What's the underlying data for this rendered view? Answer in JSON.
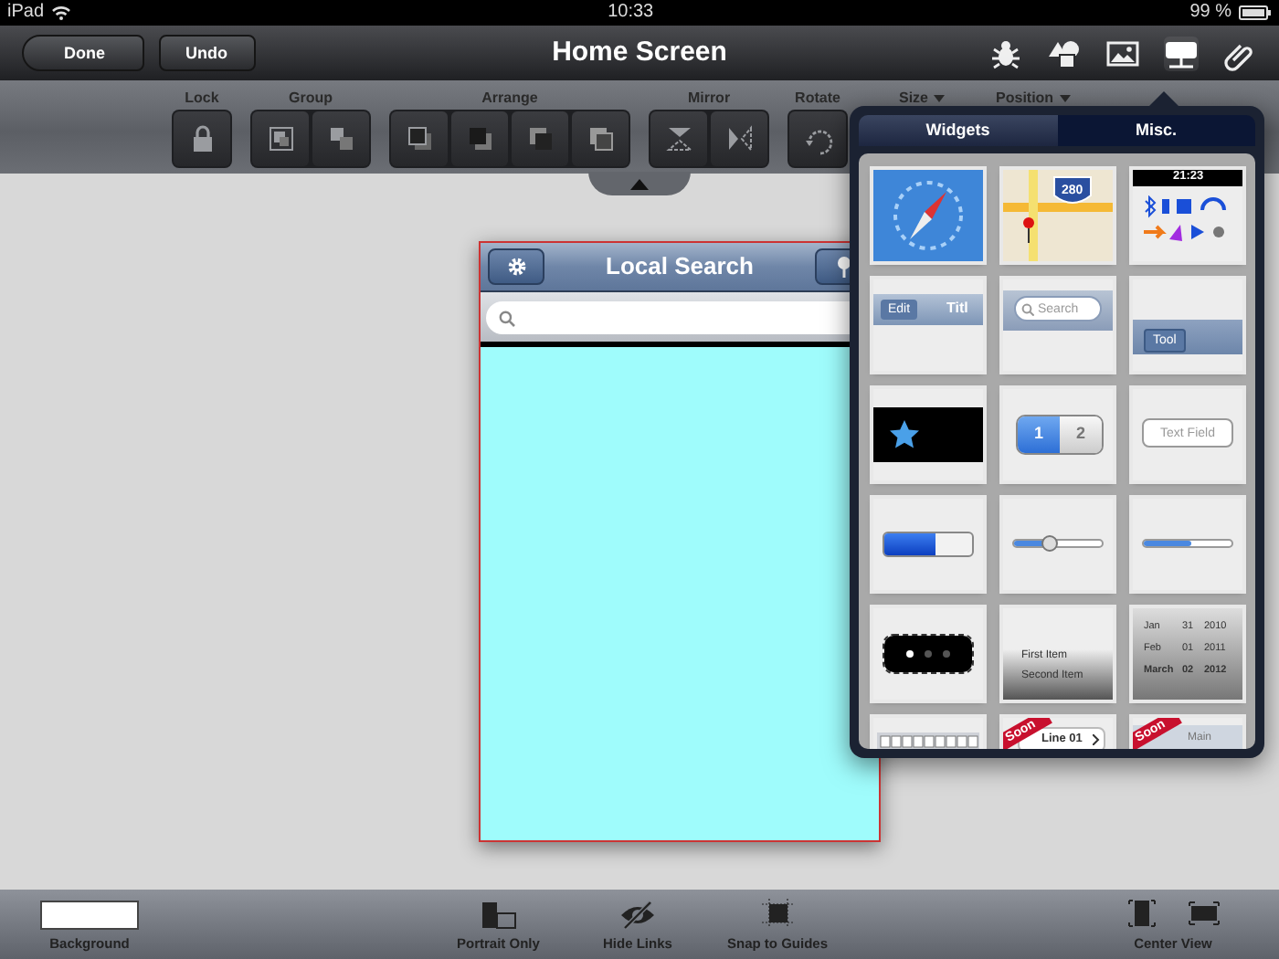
{
  "status_bar": {
    "device": "iPad",
    "time": "10:33",
    "battery": "99 %"
  },
  "nav_bar": {
    "title": "Home Screen",
    "buttons": [
      {
        "label": "Done",
        "kind": "back"
      },
      {
        "label": "Undo",
        "kind": "plain"
      }
    ],
    "icons": [
      {
        "kind": "bug",
        "selected": false
      },
      {
        "kind": "shapes",
        "selected": false
      },
      {
        "kind": "image",
        "selected": false
      },
      {
        "kind": "widget",
        "selected": true
      },
      {
        "kind": "clip",
        "selected": false
      }
    ]
  },
  "toolbar": {
    "groups": [
      {
        "label": "Lock",
        "kind": "buttons",
        "buttons": [
          {
            "kind": "lock"
          }
        ]
      },
      {
        "label": "Group",
        "kind": "buttons",
        "buttons": [
          {
            "kind": "group"
          },
          {
            "kind": "ungroup"
          }
        ]
      },
      {
        "label": "Arrange",
        "kind": "buttons",
        "buttons": [
          {
            "kind": "front"
          },
          {
            "kind": "forward"
          },
          {
            "kind": "backward"
          },
          {
            "kind": "back"
          }
        ]
      },
      {
        "label": "Mirror",
        "kind": "buttons",
        "buttons": [
          {
            "kind": "flipv"
          },
          {
            "kind": "fliph"
          }
        ]
      },
      {
        "label": "Rotate",
        "kind": "buttons",
        "buttons": [
          {
            "kind": "rotate"
          }
        ]
      },
      {
        "label": "Size",
        "kind": "dropdown"
      },
      {
        "label": "Position",
        "kind": "dropdown"
      }
    ]
  },
  "mockup": {
    "title": "Local Search"
  },
  "popover": {
    "tabs": [
      {
        "label": "Widgets",
        "selected": true
      },
      {
        "label": "Misc.",
        "selected": false
      }
    ],
    "tiles": [
      {
        "kind": "compass"
      },
      {
        "kind": "map",
        "texts": [
          "280"
        ]
      },
      {
        "kind": "statusbar",
        "texts": [
          "21:23"
        ]
      },
      {
        "kind": "navbar",
        "texts": [
          "Edit",
          "Titl"
        ]
      },
      {
        "kind": "searchbar",
        "texts": [
          "Search"
        ]
      },
      {
        "kind": "toolbar",
        "texts": [
          "Tool"
        ]
      },
      {
        "kind": "tabbar"
      },
      {
        "kind": "segmented",
        "segments": [
          {
            "label": "1",
            "selected": true
          },
          {
            "label": "2",
            "selected": false
          }
        ]
      },
      {
        "kind": "textfield",
        "placeholder": "Text Field"
      },
      {
        "kind": "switch",
        "on": true
      },
      {
        "kind": "slider",
        "level": 0.4
      },
      {
        "kind": "progress",
        "level": 0.55
      },
      {
        "kind": "pagecontrol",
        "dots": [
          {
            "selected": true
          },
          {
            "selected": false
          },
          {
            "selected": false
          }
        ]
      },
      {
        "kind": "picker",
        "texts": [
          "First Item",
          "Second Item"
        ]
      },
      {
        "kind": "datepicker",
        "rows": [
          [
            "Jan",
            "31",
            "2010"
          ],
          [
            "Feb",
            "01",
            "2011"
          ],
          [
            "March",
            "02",
            "2012"
          ]
        ]
      },
      {
        "kind": "keyboard"
      },
      {
        "kind": "tablecell",
        "texts": [
          "Soon",
          "Line 01"
        ]
      },
      {
        "kind": "splitview",
        "texts": [
          "Soon",
          "Main"
        ]
      }
    ]
  },
  "bottom_bar": {
    "items": [
      {
        "label": "Background",
        "kind": "swatch"
      },
      {
        "label": "Portrait Only",
        "kind": "portrait"
      },
      {
        "label": "Hide Links",
        "kind": "hide"
      },
      {
        "label": "Snap to Guides",
        "kind": "snap"
      },
      {
        "label": "Center View",
        "kind": "center"
      }
    ]
  }
}
